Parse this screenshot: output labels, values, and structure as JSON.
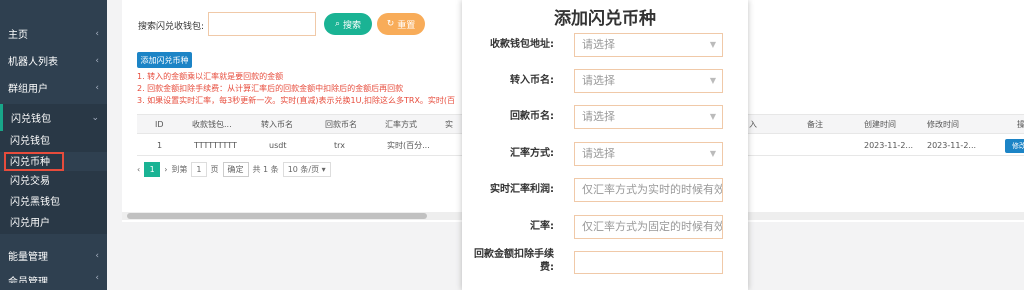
{
  "sidebar": {
    "items": [
      {
        "label": "主页",
        "arrow": "‹"
      },
      {
        "label": "机器人列表",
        "arrow": "‹"
      },
      {
        "label": "群组用户",
        "arrow": "‹"
      },
      {
        "label": "闪兑钱包",
        "arrow": "⌄"
      }
    ],
    "subitems": [
      "闪兑钱包",
      "闪兑币种",
      "闪兑交易",
      "闪兑黑钱包",
      "闪兑用户"
    ],
    "bottom": [
      {
        "label": "能量管理",
        "arrow": "‹"
      },
      {
        "label": "会员管理",
        "arrow": "‹"
      }
    ]
  },
  "search": {
    "label": "搜索闪兑收钱包:",
    "value": "",
    "search_btn": "搜索",
    "reset_btn": "重置"
  },
  "add_button": "添加闪兑币种",
  "notes": [
    "1. 转入的金额乘以汇率就是要回款的金额",
    "2. 回款金额扣除手续费：从计算汇率后的回款金额中扣除后的金额后再回款",
    "3. 如果设置实时汇率，每3秒更新一次。实时(直减)表示兑换1U,扣除这么多TRX。实时(百"
  ],
  "table": {
    "headers": [
      "ID",
      "收款钱包...",
      "转入币名",
      "回款币名",
      "汇率方式",
      "实",
      "入",
      "备注",
      "创建时间",
      "修改时间",
      "操"
    ],
    "rows": [
      [
        "1",
        "TTTTTTTTT",
        "usdt",
        "trx",
        "实时(百分...",
        "",
        "",
        "",
        "2023-11-2...",
        "2023-11-2...",
        "修改"
      ]
    ]
  },
  "pager": {
    "prev": "‹",
    "page": "1",
    "next": "›",
    "goto": "到第",
    "page_input": "1",
    "page_unit": "页",
    "confirm": "确定",
    "total": "共 1 条",
    "per_page": "10 条/页"
  },
  "modal": {
    "title": "添加闪兑币种",
    "fields": [
      {
        "label": "收款钱包地址:",
        "placeholder": "请选择",
        "type": "select"
      },
      {
        "label": "转入币名:",
        "placeholder": "请选择",
        "type": "select"
      },
      {
        "label": "回款币名:",
        "placeholder": "请选择",
        "type": "select"
      },
      {
        "label": "汇率方式:",
        "placeholder": "请选择",
        "type": "select"
      },
      {
        "label": "实时汇率利润:",
        "placeholder": "仅汇率方式为实时的时候有效",
        "type": "input"
      },
      {
        "label": "汇率:",
        "placeholder": "仅汇率方式为固定的时候有效",
        "type": "input"
      },
      {
        "label": "回款金额扣除手续费:",
        "placeholder": "",
        "type": "input"
      }
    ]
  }
}
